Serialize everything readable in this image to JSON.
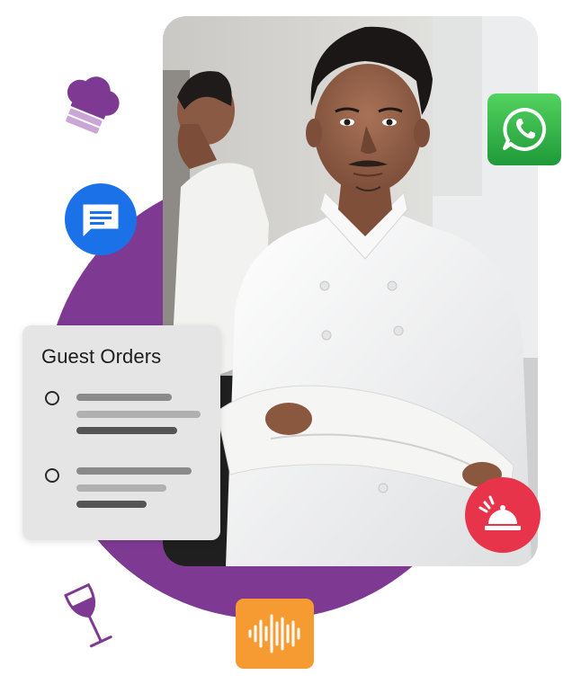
{
  "orders_card": {
    "title": "Guest Orders",
    "items": [
      {
        "selected": false
      },
      {
        "selected": false
      }
    ]
  },
  "colors": {
    "brand_purple": "#7e3a93",
    "whatsapp_green": "#2fb44a",
    "messages_blue": "#1b72e8",
    "bell_red": "#e8344b",
    "audio_orange": "#f59b32"
  },
  "icons": [
    "chef-hat-icon",
    "messages-icon",
    "whatsapp-icon",
    "service-bell-icon",
    "audio-wave-icon",
    "wine-glass-icon"
  ]
}
